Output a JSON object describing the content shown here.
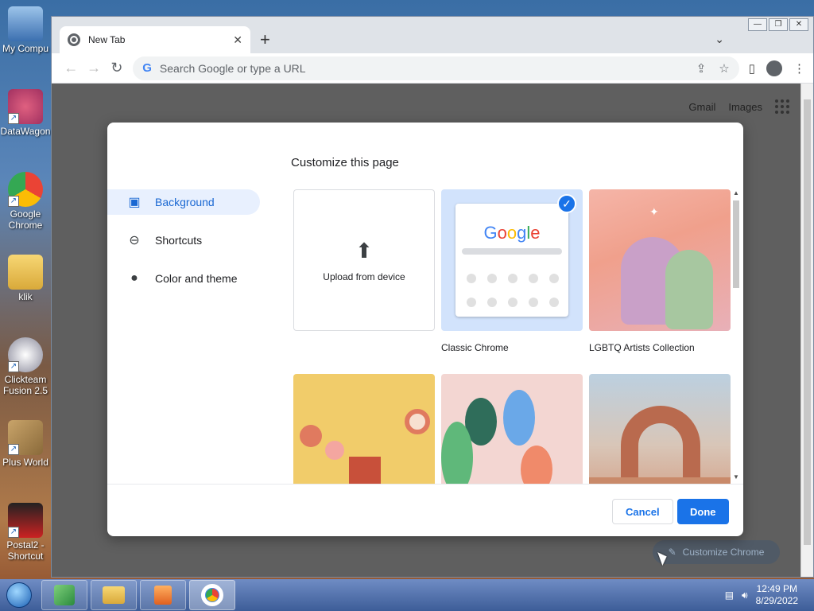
{
  "desktop": {
    "icons": [
      {
        "label": "My Compu"
      },
      {
        "label": "DataWagon"
      },
      {
        "label": "Google Chrome"
      },
      {
        "label": "klik"
      },
      {
        "label": "Clickteam Fusion 2.5"
      },
      {
        "label": "Plus World"
      },
      {
        "label": "Postal2 - Shortcut"
      }
    ]
  },
  "window": {
    "controls": {
      "minimize": "—",
      "maximize": "❐",
      "close": "✕"
    }
  },
  "browser": {
    "tab": {
      "title": "New Tab",
      "close": "✕"
    },
    "new_tab": "+",
    "tab_dropdown": "⌄",
    "omnibox": {
      "placeholder": "Search Google or type a URL",
      "g": "G"
    },
    "nav": {
      "back": "←",
      "forward": "→",
      "reload": "↻"
    },
    "icons": {
      "share": "⇪",
      "star": "☆",
      "sidepanel": "▯",
      "menu": "⋮"
    }
  },
  "newtab_page": {
    "gmail": "Gmail",
    "images": "Images",
    "customize_chrome": "Customize Chrome"
  },
  "dialog": {
    "title": "Customize this page",
    "nav": [
      {
        "label": "Background",
        "active": true,
        "icon": "image-icon"
      },
      {
        "label": "Shortcuts",
        "active": false,
        "icon": "link-icon"
      },
      {
        "label": "Color and theme",
        "active": false,
        "icon": "palette-icon"
      }
    ],
    "tiles": [
      {
        "label": "Upload from device",
        "kind": "upload"
      },
      {
        "label": "Classic Chrome",
        "kind": "classic",
        "selected": true
      },
      {
        "label": "LGBTQ Artists Collection",
        "kind": "lgbtq"
      },
      {
        "label": "",
        "kind": "yellow"
      },
      {
        "label": "",
        "kind": "floral"
      },
      {
        "label": "",
        "kind": "arch"
      }
    ],
    "classic_logo": [
      "G",
      "o",
      "o",
      "g",
      "l",
      "e"
    ],
    "cancel": "Cancel",
    "done": "Done"
  },
  "taskbar": {
    "time": "12:49 PM",
    "date": "8/29/2022"
  },
  "colors": {
    "accent": "#1a73e8",
    "google_blue": "#4285f4",
    "google_red": "#ea4335",
    "google_yellow": "#fbbc05",
    "google_green": "#34a853"
  }
}
